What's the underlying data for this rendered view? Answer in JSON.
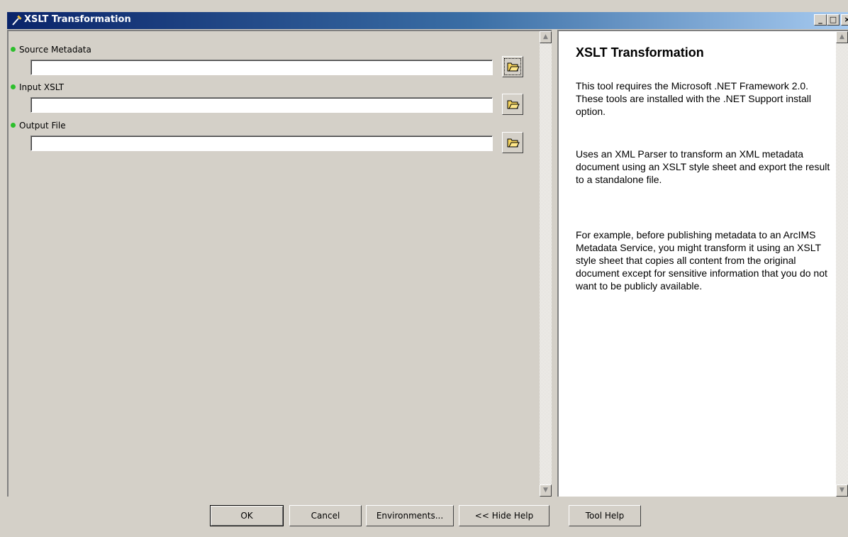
{
  "window": {
    "title": "XSLT Transformation",
    "min_glyph": "_",
    "max_glyph": "□",
    "close_glyph": "×"
  },
  "params": [
    {
      "label": "Source Metadata",
      "value": ""
    },
    {
      "label": "Input XSLT",
      "value": ""
    },
    {
      "label": "Output File",
      "value": ""
    }
  ],
  "help": {
    "title": "XSLT Transformation",
    "p1": "This tool requires the Microsoft .NET Framework 2.0. These tools are installed with the .NET Support install option.",
    "p2": "Uses an XML Parser to transform an XML metadata document using an XSLT style sheet and export the result to a standalone file.",
    "p3": "For example, before publishing metadata to an ArcIMS Metadata Service, you might transform it using an XSLT style sheet that copies all content from the original document except for sensitive information that you do not want to be publicly available."
  },
  "buttons": {
    "ok": "OK",
    "cancel": "Cancel",
    "environments": "Environments...",
    "hide_help": "<< Hide Help",
    "tool_help": "Tool Help"
  },
  "icons": {
    "title": "hammer-icon",
    "browse": "open-folder-icon",
    "required": "green-dot-icon"
  },
  "colors": {
    "required_dot": "#2cbf2c",
    "title_start": "#0a246a",
    "title_end": "#a6caf0"
  }
}
